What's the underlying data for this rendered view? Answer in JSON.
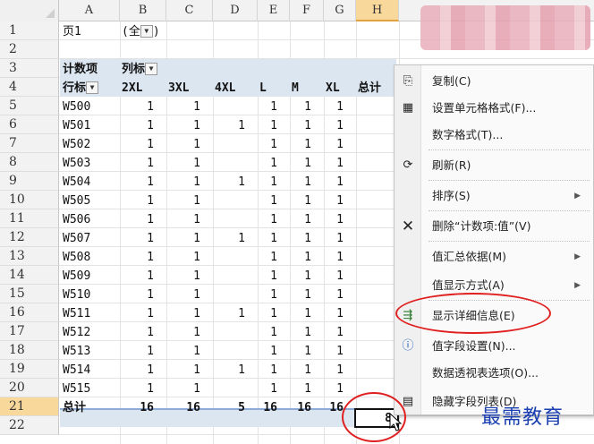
{
  "columns": [
    "A",
    "B",
    "C",
    "D",
    "E",
    "F",
    "G",
    "H"
  ],
  "row_numbers": [
    "1",
    "2",
    "3",
    "4",
    "5",
    "6",
    "7",
    "8",
    "9",
    "10",
    "11",
    "12",
    "13",
    "14",
    "15",
    "16",
    "17",
    "18",
    "19",
    "20",
    "21",
    "22"
  ],
  "filter": {
    "label": "页1",
    "value": "(全",
    "close": ")"
  },
  "pivot": {
    "corner_label": "计数项",
    "col_label": "列标",
    "row_label": "行标",
    "headers": [
      "2XL",
      "3XL",
      "4XL",
      "L",
      "M",
      "XL",
      "总计"
    ],
    "rows": [
      {
        "name": "W500",
        "vals": [
          "1",
          "1",
          "",
          "1",
          "1",
          "1"
        ]
      },
      {
        "name": "W501",
        "vals": [
          "1",
          "1",
          "1",
          "1",
          "1",
          "1"
        ]
      },
      {
        "name": "W502",
        "vals": [
          "1",
          "1",
          "",
          "1",
          "1",
          "1"
        ]
      },
      {
        "name": "W503",
        "vals": [
          "1",
          "1",
          "",
          "1",
          "1",
          "1"
        ]
      },
      {
        "name": "W504",
        "vals": [
          "1",
          "1",
          "1",
          "1",
          "1",
          "1"
        ]
      },
      {
        "name": "W505",
        "vals": [
          "1",
          "1",
          "",
          "1",
          "1",
          "1"
        ]
      },
      {
        "name": "W506",
        "vals": [
          "1",
          "1",
          "",
          "1",
          "1",
          "1"
        ]
      },
      {
        "name": "W507",
        "vals": [
          "1",
          "1",
          "1",
          "1",
          "1",
          "1"
        ]
      },
      {
        "name": "W508",
        "vals": [
          "1",
          "1",
          "",
          "1",
          "1",
          "1"
        ]
      },
      {
        "name": "W509",
        "vals": [
          "1",
          "1",
          "",
          "1",
          "1",
          "1"
        ]
      },
      {
        "name": "W510",
        "vals": [
          "1",
          "1",
          "",
          "1",
          "1",
          "1"
        ]
      },
      {
        "name": "W511",
        "vals": [
          "1",
          "1",
          "1",
          "1",
          "1",
          "1"
        ]
      },
      {
        "name": "W512",
        "vals": [
          "1",
          "1",
          "",
          "1",
          "1",
          "1"
        ]
      },
      {
        "name": "W513",
        "vals": [
          "1",
          "1",
          "",
          "1",
          "1",
          "1"
        ]
      },
      {
        "name": "W514",
        "vals": [
          "1",
          "1",
          "1",
          "1",
          "1",
          "1"
        ]
      },
      {
        "name": "W515",
        "vals": [
          "1",
          "1",
          "",
          "1",
          "1",
          "1"
        ]
      }
    ],
    "total_label": "总计",
    "totals": [
      "16",
      "16",
      "5",
      "16",
      "16",
      "16"
    ],
    "grand_total": "8"
  },
  "context_menu": {
    "items": [
      {
        "label": "复制(C)",
        "icon": "copy-icon",
        "glyph": "⎘"
      },
      {
        "label": "设置单元格格式(F)...",
        "icon": "format-cells-icon",
        "glyph": "▦"
      },
      {
        "label": "数字格式(T)...",
        "icon": "",
        "glyph": ""
      },
      {
        "label": "刷新(R)",
        "icon": "refresh-icon",
        "glyph": "⟳"
      },
      {
        "label": "排序(S)",
        "icon": "",
        "glyph": "",
        "submenu": true
      },
      {
        "label": "删除“计数项:值”(V)",
        "icon": "delete-icon",
        "glyph": "✕"
      },
      {
        "label": "值汇总依据(M)",
        "icon": "",
        "glyph": "",
        "submenu": true
      },
      {
        "label": "值显示方式(A)",
        "icon": "",
        "glyph": "",
        "submenu": true
      },
      {
        "label": "显示详细信息(E)",
        "icon": "show-details-icon",
        "glyph": "⇶"
      },
      {
        "label": "值字段设置(N)...",
        "icon": "field-settings-icon",
        "glyph": "ⓘ"
      },
      {
        "label": "数据透视表选项(O)...",
        "icon": "",
        "glyph": ""
      },
      {
        "label": "隐藏字段列表(D)",
        "icon": "field-list-icon",
        "glyph": "▤"
      }
    ]
  },
  "watermark": "最需教育",
  "colors": {
    "accent_red": "#e02020",
    "pivot_header": "#dce6f1",
    "selected_header": "#f9d99b",
    "watermark": "#1a3fb0"
  }
}
